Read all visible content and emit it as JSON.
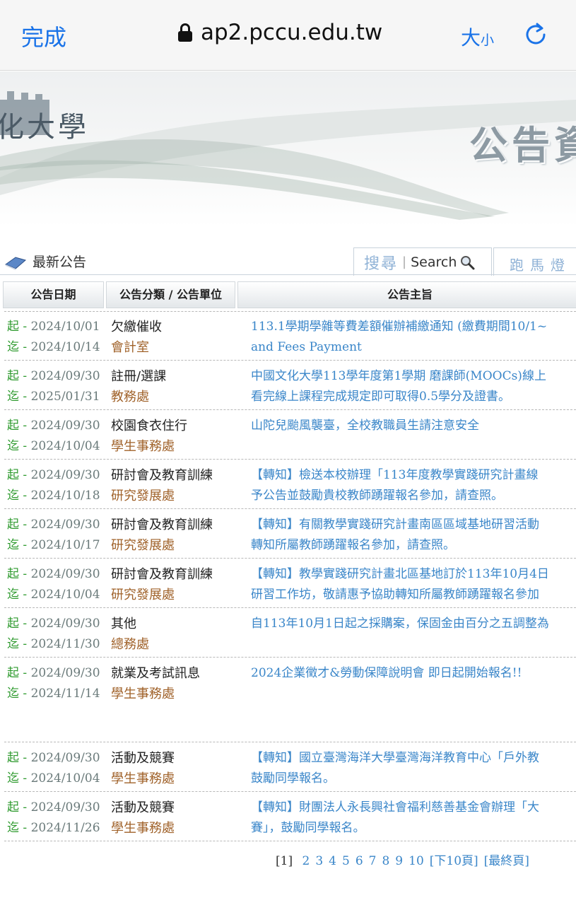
{
  "browser": {
    "done_label": "完成",
    "url": "ap2.pccu.edu.tw",
    "text_size_big": "大",
    "text_size_small": "小"
  },
  "banner": {
    "logo_text": "化大學",
    "title": "公告資"
  },
  "news": {
    "label": "最新公告",
    "search_zh": "搜尋",
    "search_en": "Search",
    "marquee": "跑馬燈"
  },
  "table": {
    "headers": [
      "公告日期",
      "公告分類 / 公告單位",
      "公告主旨"
    ],
    "start_prefix": "起 - ",
    "end_prefix": "迄 - ",
    "rows": [
      {
        "start": "2024/10/01",
        "end": "2024/10/14",
        "category": "欠繳催收",
        "unit": "會計室",
        "subject": [
          "113.1學期學雜等費差額催辦補繳通知 (繳費期間10/1~",
          "and Fees Payment"
        ]
      },
      {
        "start": "2024/09/30",
        "end": "2025/01/31",
        "category": "註冊/選課",
        "unit": "教務處",
        "subject": [
          "中國文化大學113學年度第1學期 磨課師(MOOCs)線上",
          "看完線上課程完成規定即可取得0.5學分及證書。"
        ]
      },
      {
        "start": "2024/09/30",
        "end": "2024/10/04",
        "category": "校園食衣住行",
        "unit": "學生事務處",
        "subject": [
          "山陀兒颱風襲臺，全校教職員生請注意安全",
          ""
        ]
      },
      {
        "start": "2024/09/30",
        "end": "2024/10/18",
        "category": "研討會及教育訓練",
        "unit": "研究發展處",
        "subject": [
          "【轉知】檢送本校辦理「113年度教學實踐研究計畫線",
          "予公告並鼓勵貴校教師踴躍報名參加，請查照。"
        ]
      },
      {
        "start": "2024/09/30",
        "end": "2024/10/17",
        "category": "研討會及教育訓練",
        "unit": "研究發展處",
        "subject": [
          "【轉知】有關教學實踐研究計畫南區區域基地研習活動",
          "轉知所屬教師踴躍報名參加，請查照。"
        ]
      },
      {
        "start": "2024/09/30",
        "end": "2024/10/04",
        "category": "研討會及教育訓練",
        "unit": "研究發展處",
        "subject": [
          "【轉知】教學實踐研究計畫北區基地訂於113年10月4日",
          "研習工作坊，敬請惠予協助轉知所屬教師踴躍報名參加"
        ]
      },
      {
        "start": "2024/09/30",
        "end": "2024/11/30",
        "category": "其他",
        "unit": "總務處",
        "subject": [
          "自113年10月1日起之採購案，保固金由百分之五調整為",
          ""
        ]
      },
      {
        "start": "2024/09/30",
        "end": "2024/11/14",
        "category": "就業及考試訊息",
        "unit": "學生事務處",
        "subject": [
          "2024企業徵才&勞動保障說明會 即日起開始報名!!",
          ""
        ],
        "tall": true
      },
      {
        "start": "2024/09/30",
        "end": "2024/10/04",
        "category": "活動及競賽",
        "unit": "學生事務處",
        "subject": [
          "【轉知】國立臺灣海洋大學臺灣海洋教育中心「戶外教",
          "鼓勵同學報名。"
        ]
      },
      {
        "start": "2024/09/30",
        "end": "2024/11/26",
        "category": "活動及競賽",
        "unit": "學生事務處",
        "subject": [
          "【轉知】財團法人永長興社會福利慈善基金會辦理「大",
          "賽」，鼓勵同學報名。"
        ]
      }
    ]
  },
  "pager": {
    "current": "[1]",
    "pages": [
      "2",
      "3",
      "4",
      "5",
      "6",
      "7",
      "8",
      "9",
      "10"
    ],
    "next10": "[下10頁]",
    "last": "[最終頁]"
  }
}
